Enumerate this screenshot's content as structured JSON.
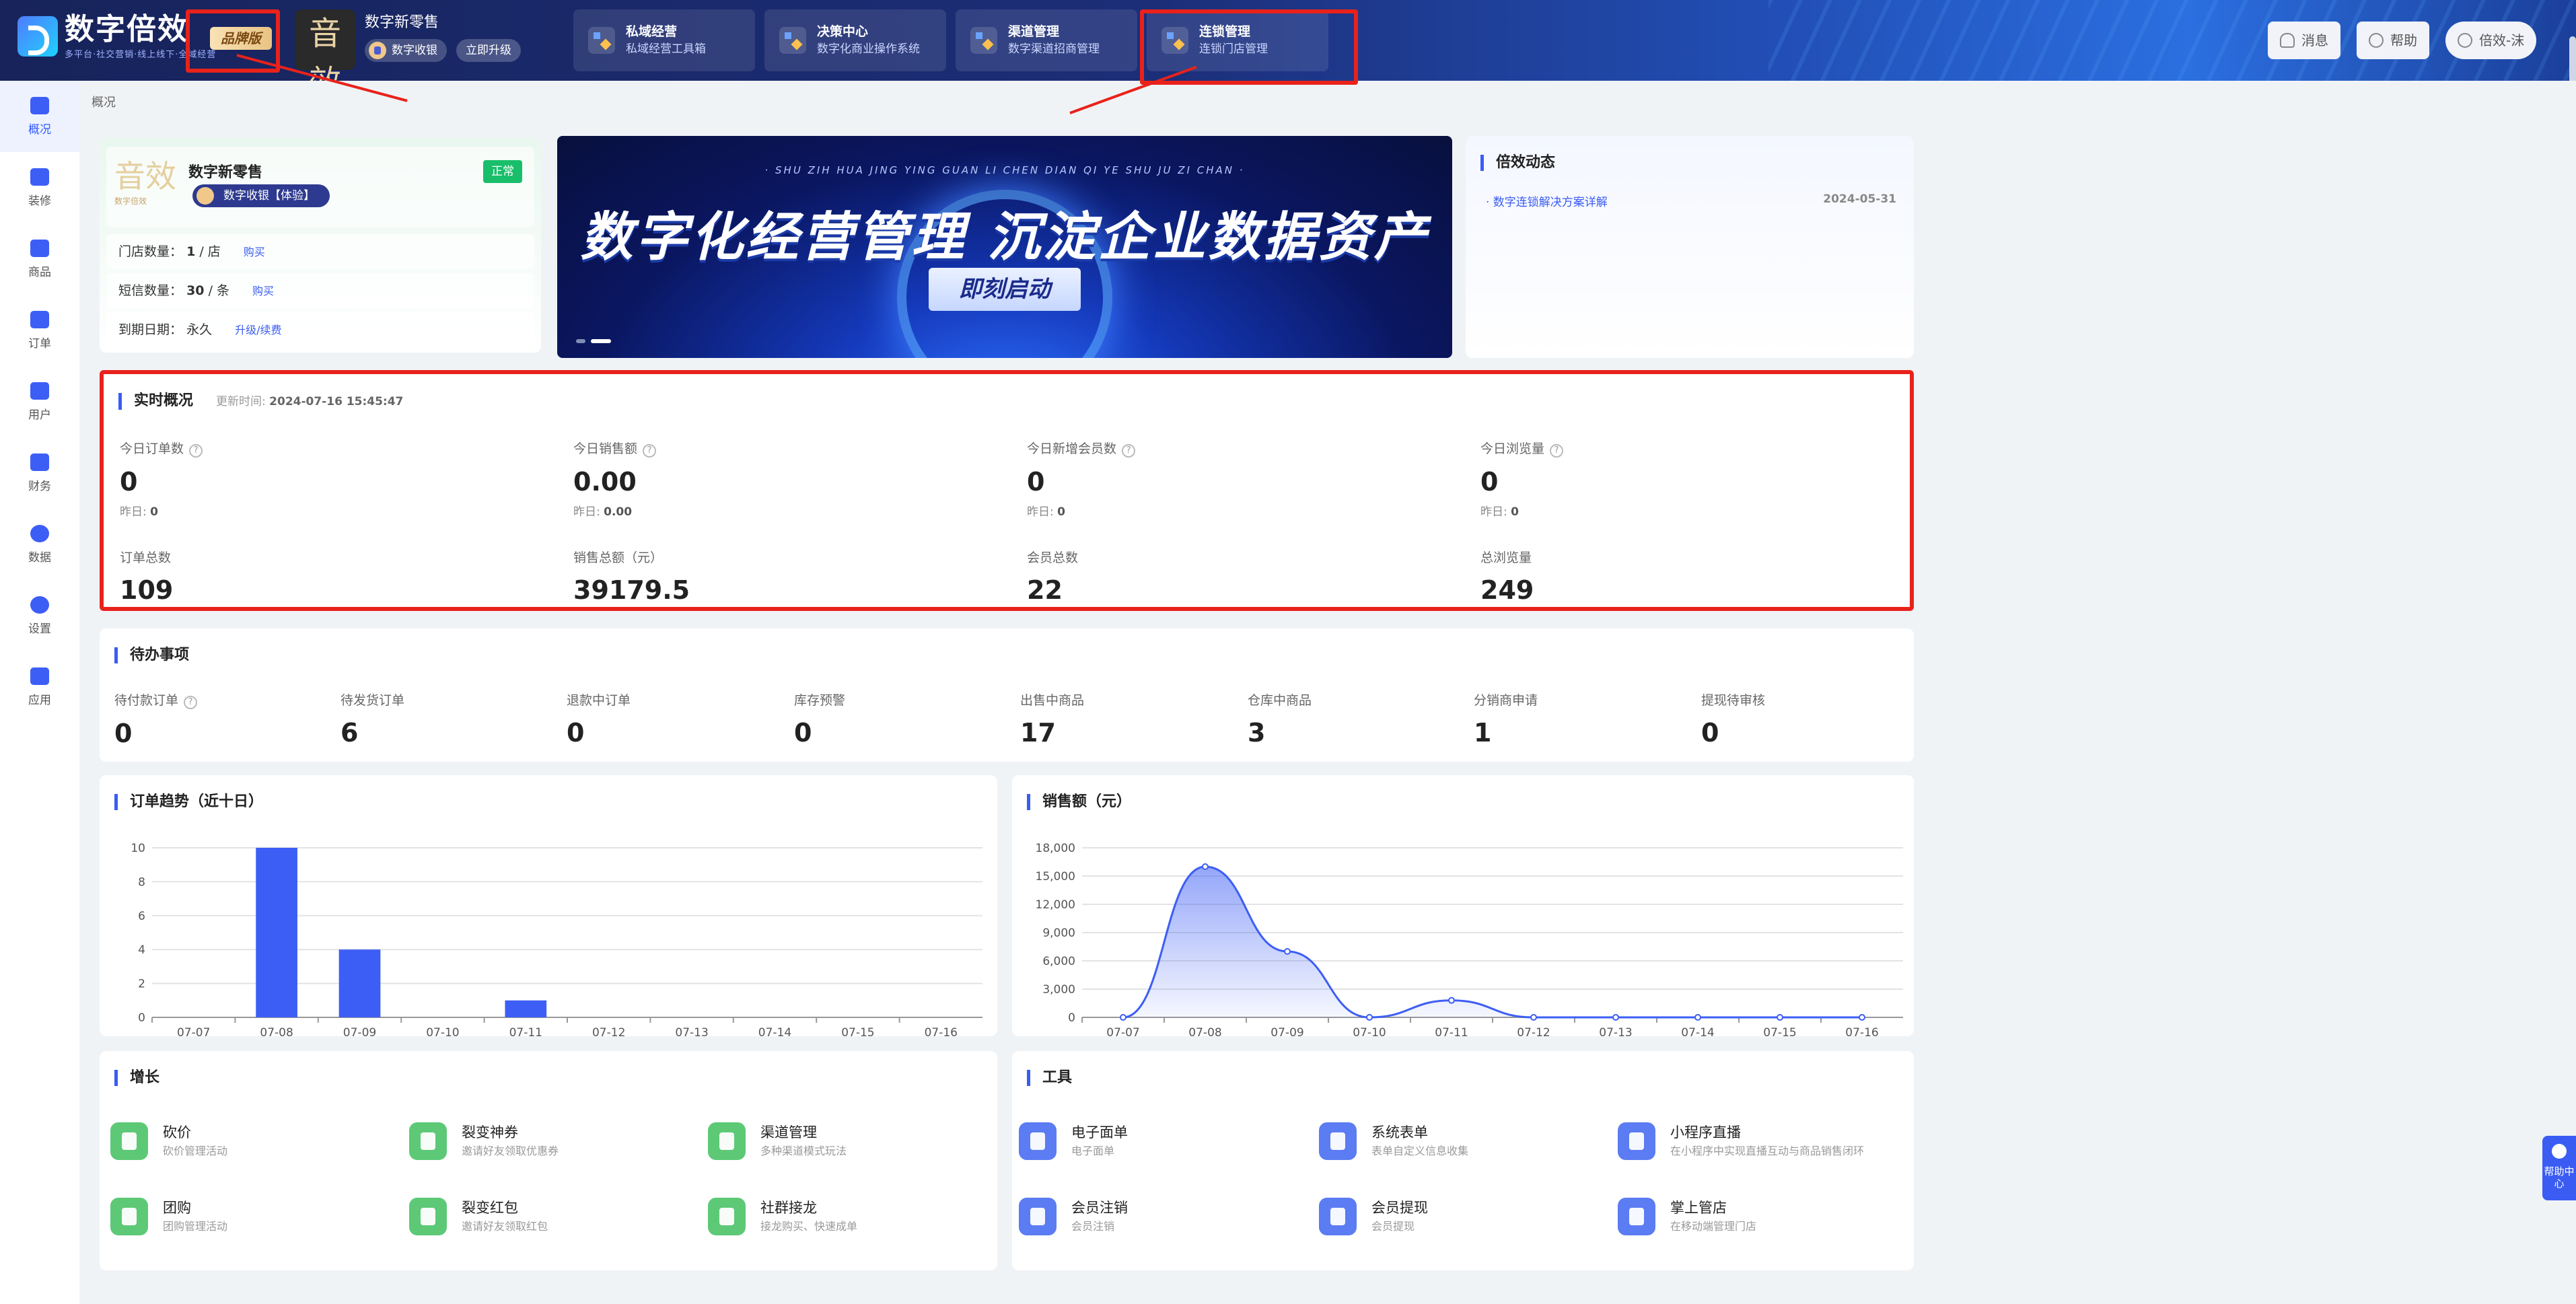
{
  "app": {
    "logo_text": "数字倍效",
    "logo_sub": "多平台·社交营销·线上线下·全域经营",
    "brand_tag": "品牌版"
  },
  "shop": {
    "name": "数字新零售",
    "avatar_char": "音效",
    "avatar_sub": "数字倍效",
    "edition": "数字收银",
    "upgrade": "立即升级"
  },
  "nav_cards": [
    {
      "title": "私域经营",
      "desc": "私域经营工具箱"
    },
    {
      "title": "决策中心",
      "desc": "数字化商业操作系统"
    },
    {
      "title": "渠道管理",
      "desc": "数字渠道招商管理"
    },
    {
      "title": "连锁管理",
      "desc": "连锁门店管理"
    }
  ],
  "top_buttons": {
    "message": "消息",
    "help": "帮助",
    "user": "倍效-沫"
  },
  "sidebar": [
    "概况",
    "装修",
    "商品",
    "订单",
    "用户",
    "财务",
    "数据",
    "设置",
    "应用"
  ],
  "breadcrumb": "概况",
  "shop_card": {
    "name": "数字新零售",
    "badge": "数字收银【体验】",
    "status": "正常",
    "stores_label": "门店数量：",
    "stores_value": "1",
    "stores_unit": "/ 店",
    "stores_link": "购买",
    "sms_label": "短信数量：",
    "sms_value": "30",
    "sms_unit": "/ 条",
    "sms_link": "购买",
    "expire_label": "到期日期：",
    "expire_value": "永久",
    "expire_link": "升级/续费"
  },
  "banner": {
    "pinyin": "· SHU ZIH HUA JING YING GUAN LI  CHEN DIAN QI YE SHU JU ZI CHAN ·",
    "title": "数字化经营管理 沉淀企业数据资产",
    "button": "即刻启动"
  },
  "news": {
    "title": "倍效动态",
    "items": [
      {
        "text": "· 数字连锁解决方案详解",
        "date": "2024-05-31"
      }
    ]
  },
  "realtime": {
    "title": "实时概况",
    "update_label": "更新时间:",
    "update_time": "2024-07-16 15:45:47",
    "today": [
      {
        "label": "今日订单数",
        "value": "0",
        "y_label": "昨日:",
        "y_value": "0"
      },
      {
        "label": "今日销售额",
        "value": "0.00",
        "y_label": "昨日:",
        "y_value": "0.00"
      },
      {
        "label": "今日新增会员数",
        "value": "0",
        "y_label": "昨日:",
        "y_value": "0"
      },
      {
        "label": "今日浏览量",
        "value": "0",
        "y_label": "昨日:",
        "y_value": "0"
      }
    ],
    "totals": [
      {
        "label": "订单总数",
        "value": "109"
      },
      {
        "label": "销售总额（元）",
        "value": "39179.5"
      },
      {
        "label": "会员总数",
        "value": "22"
      },
      {
        "label": "总浏览量",
        "value": "249"
      }
    ]
  },
  "todo": {
    "title": "待办事项",
    "items": [
      {
        "label": "待付款订单",
        "value": "0"
      },
      {
        "label": "待发货订单",
        "value": "6"
      },
      {
        "label": "退款中订单",
        "value": "0"
      },
      {
        "label": "库存预警",
        "value": "0"
      },
      {
        "label": "出售中商品",
        "value": "17"
      },
      {
        "label": "仓库中商品",
        "value": "3"
      },
      {
        "label": "分销商申请",
        "value": "1"
      },
      {
        "label": "提现待审核",
        "value": "0"
      }
    ]
  },
  "chart_data": [
    {
      "type": "bar",
      "title": "订单趋势（近十日）",
      "categories": [
        "07-07",
        "07-08",
        "07-09",
        "07-10",
        "07-11",
        "07-12",
        "07-13",
        "07-14",
        "07-15",
        "07-16"
      ],
      "values": [
        0,
        10,
        4,
        0,
        1,
        0,
        0,
        0,
        0,
        0
      ],
      "ylim": [
        0,
        10
      ],
      "yticks": [
        "0",
        "2",
        "4",
        "6",
        "8",
        "10"
      ],
      "grid": true,
      "color": "#3d5ef5"
    },
    {
      "type": "area",
      "title": "销售额（元）",
      "categories": [
        "07-07",
        "07-08",
        "07-09",
        "07-10",
        "07-11",
        "07-12",
        "07-13",
        "07-14",
        "07-15",
        "07-16"
      ],
      "values": [
        0,
        16000,
        7000,
        0,
        1800,
        0,
        0,
        0,
        0,
        0
      ],
      "ylim": [
        0,
        18000
      ],
      "yticks": [
        "0",
        "3,000",
        "6,000",
        "9,000",
        "12,000",
        "15,000",
        "18,000"
      ],
      "grid": true,
      "color": "#3d5ef5"
    }
  ],
  "growth": {
    "title": "增长",
    "items": [
      {
        "name": "砍价",
        "desc": "砍价管理活动"
      },
      {
        "name": "裂变神券",
        "desc": "邀请好友领取优惠券"
      },
      {
        "name": "渠道管理",
        "desc": "多种渠道模式玩法"
      },
      {
        "name": "团购",
        "desc": "团购管理活动"
      },
      {
        "name": "裂变红包",
        "desc": "邀请好友领取红包"
      },
      {
        "name": "社群接龙",
        "desc": "接龙购买、快速成单"
      }
    ]
  },
  "tools": {
    "title": "工具",
    "items": [
      {
        "name": "电子面单",
        "desc": "电子面单"
      },
      {
        "name": "系统表单",
        "desc": "表单自定义信息收集"
      },
      {
        "name": "小程序直播",
        "desc": "在小程序中实现直播互动与商品销售闭环"
      },
      {
        "name": "会员注销",
        "desc": "会员注销"
      },
      {
        "name": "会员提现",
        "desc": "会员提现"
      },
      {
        "name": "掌上管店",
        "desc": "在移动端管理门店"
      }
    ]
  },
  "help_fab": "帮助中心"
}
